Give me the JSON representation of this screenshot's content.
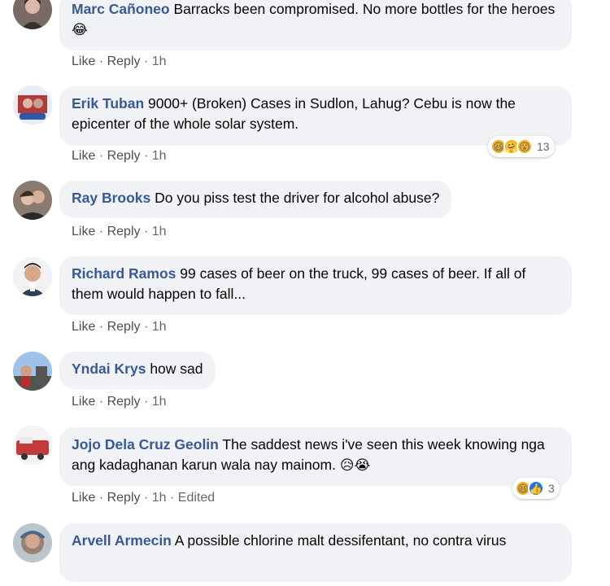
{
  "comments": [
    {
      "author": "Marc Cañoneo",
      "text": "Barracks been compromised. No more bottles for the heroes",
      "emoji": "😂",
      "like": "Like",
      "reply": "Reply",
      "time": "1h"
    },
    {
      "author": "Erik Tuban",
      "text": "9000+ (Broken) Cases in Sudlon, Lahug? Cebu is now the epicenter of the whole solar system.",
      "like": "Like",
      "reply": "Reply",
      "time": "1h",
      "reactions": {
        "icons": [
          "haha-icon",
          "care-icon",
          "wow-icon"
        ],
        "count": "13"
      }
    },
    {
      "author": "Ray Brooks",
      "text": "Do you piss test the driver for alcohol abuse?",
      "like": "Like",
      "reply": "Reply",
      "time": "1h"
    },
    {
      "author": "Richard Ramos",
      "text": "99 cases of beer on the truck, 99 cases of beer. If all of them would happen to fall...",
      "like": "Like",
      "reply": "Reply",
      "time": "1h"
    },
    {
      "author": "Yndai Krys",
      "text": "how sad",
      "like": "Like",
      "reply": "Reply",
      "time": "1h"
    },
    {
      "author": "Jojo Dela Cruz Geolin",
      "text": "The saddest news i've seen this week knowing nga ang kadaghanan karun wala nay mainom.",
      "emoji": "😥😭",
      "like": "Like",
      "reply": "Reply",
      "time": "1h",
      "edited": "Edited",
      "reactions": {
        "icons": [
          "haha-icon",
          "like-icon"
        ],
        "count": "3"
      }
    },
    {
      "author": "Arvell Armecin",
      "text": "A possible chlorine malt dessifentant, no contra virus"
    }
  ],
  "colors": {
    "author": "#385898",
    "bubble": "#f0f2f5",
    "meta": "#65676b",
    "like_blue": "#1877f2",
    "haha_yellow": "#f7b125"
  }
}
